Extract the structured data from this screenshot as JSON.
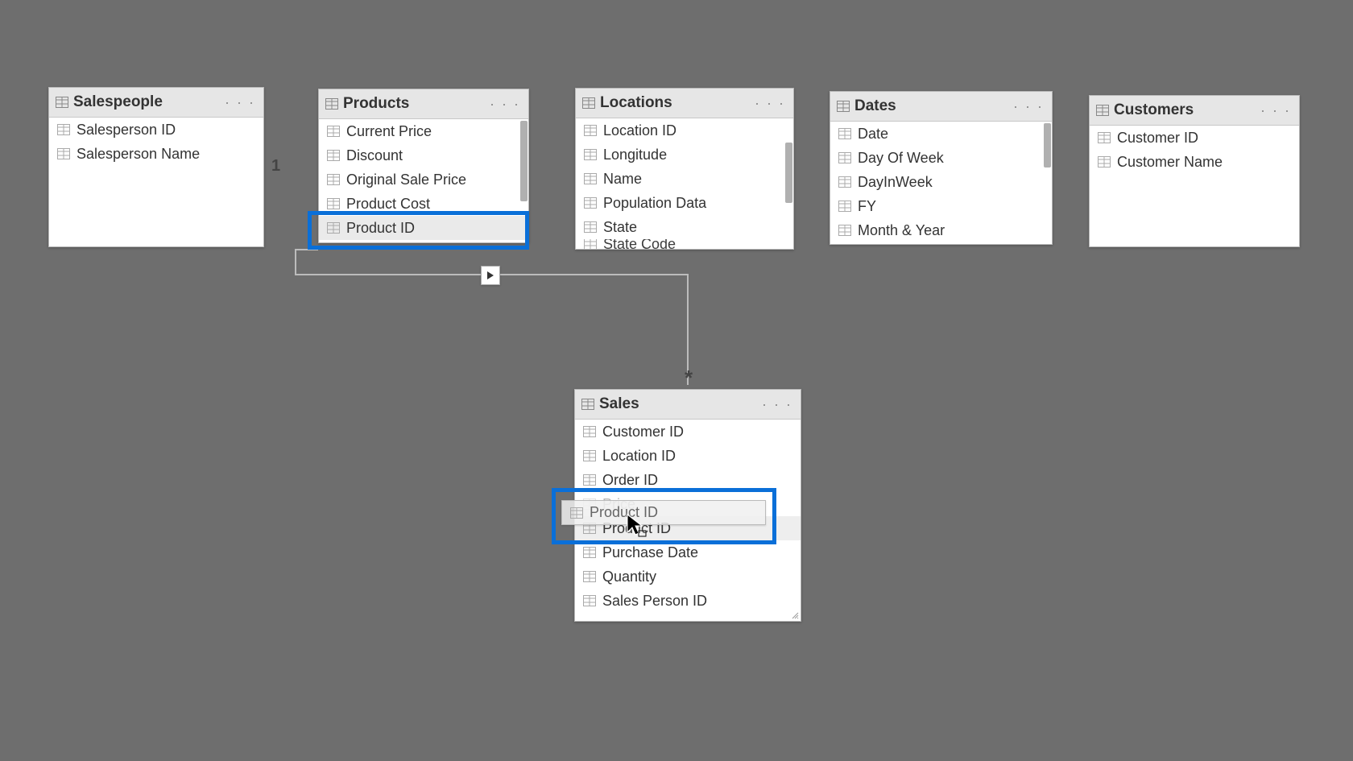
{
  "tables": {
    "salespeople": {
      "title": "Salespeople",
      "fields": [
        "Salesperson ID",
        "Salesperson Name"
      ]
    },
    "products": {
      "title": "Products",
      "fields": [
        "Current Price",
        "Discount",
        "Original Sale Price",
        "Product Cost",
        "Product ID"
      ]
    },
    "locations": {
      "title": "Locations",
      "fields": [
        "Location ID",
        "Longitude",
        "Name",
        "Population Data",
        "State",
        "State Code"
      ]
    },
    "dates": {
      "title": "Dates",
      "fields": [
        "Date",
        "Day Of Week",
        "DayInWeek",
        "FY",
        "Month & Year"
      ]
    },
    "customers": {
      "title": "Customers",
      "fields": [
        "Customer ID",
        "Customer Name"
      ]
    },
    "sales": {
      "title": "Sales",
      "fields": [
        "Customer ID",
        "Location ID",
        "Order ID",
        "Price",
        "Product ID",
        "Purchase Date",
        "Quantity",
        "Sales Person ID"
      ]
    }
  },
  "relationship": {
    "one_label": "1",
    "many_label": "*"
  },
  "drag_ghost": {
    "label": "Product ID"
  },
  "menu_dots": "· · ·"
}
